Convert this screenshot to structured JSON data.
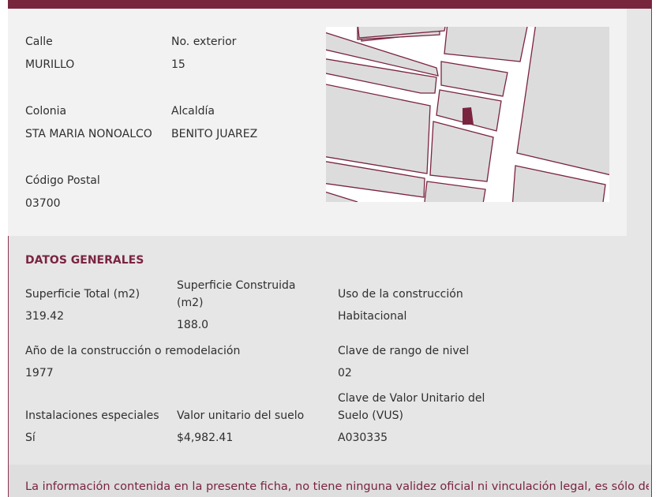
{
  "address": {
    "calle_label": "Calle",
    "calle_value": "MURILLO",
    "no_exterior_label": "No. exterior",
    "no_exterior_value": "15",
    "colonia_label": "Colonia",
    "colonia_value": "STA MARIA NONOALCO",
    "alcaldia_label": "Alcaldía",
    "alcaldia_value": "BENITO JUAREZ",
    "cp_label": "Código Postal",
    "cp_value": "03700"
  },
  "map": {
    "block_color": "#dcdcdc",
    "street_color": "#ffffff",
    "outline_color": "#7a2440",
    "parcel_color": "#7a2440"
  },
  "datos_generales": {
    "title": "DATOS GENERALES",
    "superficie_total_label": "Superficie Total (m2)",
    "superficie_total_value": "319.42",
    "superficie_construida_label": "Superficie Construida (m2)",
    "superficie_construida_value": "188.0",
    "uso_label": "Uso de la construcción",
    "uso_value": "Habitacional",
    "anio_label": "Año de la construcción o remodelación",
    "anio_value": "1977",
    "rango_label": "Clave de rango de nivel",
    "rango_value": "02",
    "instalaciones_label": "Instalaciones especiales",
    "instalaciones_value": "Sí",
    "valor_unitario_label": "Valor unitario del suelo",
    "valor_unitario_value": "$4,982.41",
    "vus_label": "Clave de Valor Unitario del Suelo (VUS)",
    "vus_value": "A030335"
  },
  "footer": {
    "disclaimer": "La información contenida en la presente ficha, no tiene ninguna validez oficial ni vinculación legal, es sólo de"
  }
}
